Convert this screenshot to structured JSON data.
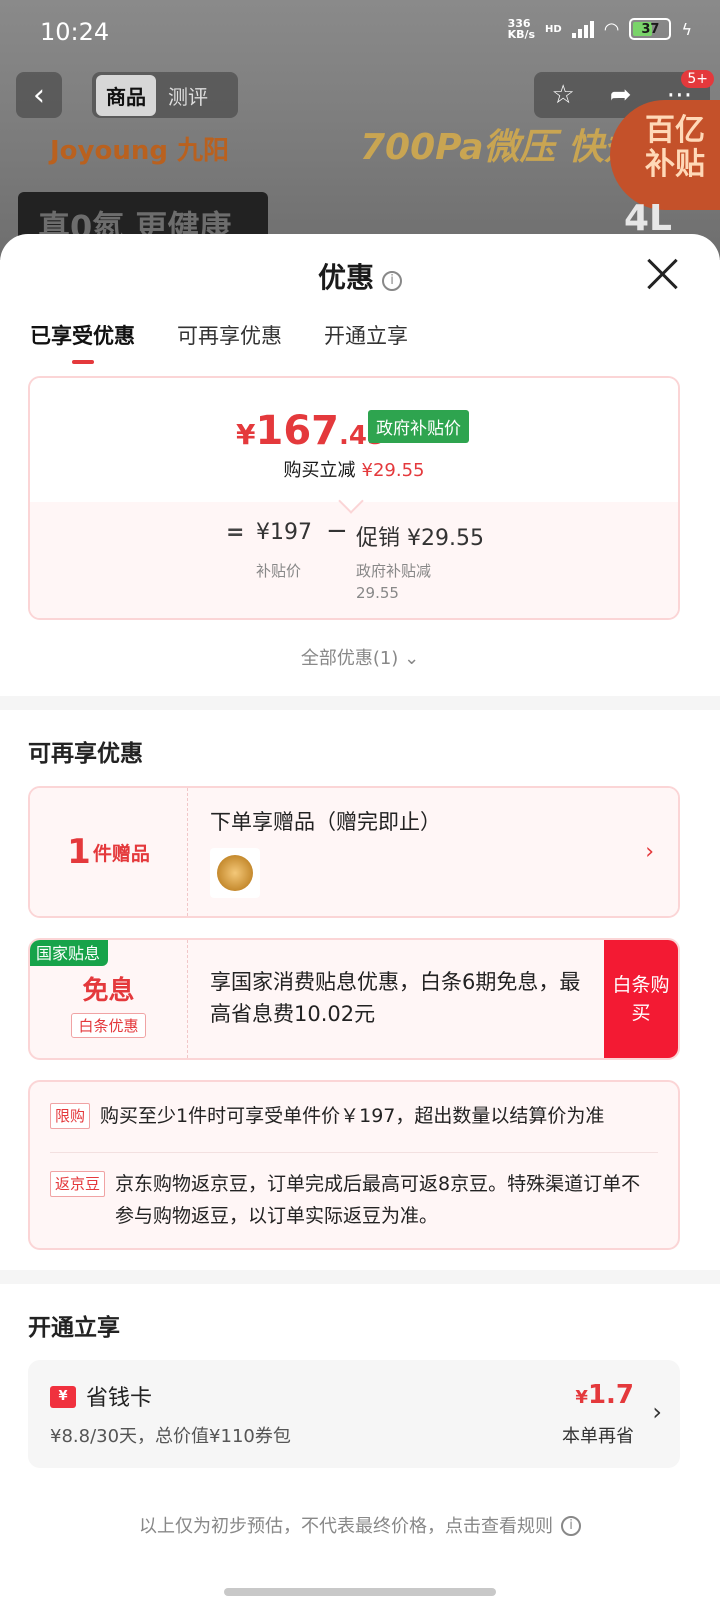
{
  "status": {
    "time": "10:24",
    "net_speed": "336",
    "net_unit": "KB/s",
    "hd": "HD",
    "battery": "37"
  },
  "background": {
    "tab_product": "商品",
    "tab_review": "测评",
    "brand": "Joyoung 九阳",
    "slogan": "700Pa微压 快煮",
    "subsidy_badge_1": "百亿",
    "subsidy_badge_2": "补贴",
    "banner_text": "真0氮 更健康",
    "size": "4L",
    "more_badge": "5+"
  },
  "sheet": {
    "title": "优惠",
    "tabs": [
      "已享受优惠",
      "可再享优惠",
      "开通立享"
    ],
    "price": {
      "yen": "¥",
      "integer": "167",
      "decimal": ".45",
      "badge": "政府补贴价"
    },
    "reduce_label": "购买立减",
    "reduce_amount": "¥29.55",
    "calc": {
      "eq": "=",
      "base": "¥197",
      "minus": "−",
      "promo": "促销 ¥29.55",
      "base_label": "补贴价",
      "promo_label_1": "政府补贴减",
      "promo_label_2": "29.55"
    },
    "all_offers": "全部优惠(1)",
    "section_more": "可再享优惠",
    "gift": {
      "count": "1",
      "count_label": "件赠品",
      "title": "下单享赠品（赠完即止）"
    },
    "interest": {
      "tag": "国家贴息",
      "big": "免息",
      "small": "白条优惠",
      "desc": "享国家消费贴息优惠，白条6期免息，最高省息费10.02元",
      "button": "白条购买"
    },
    "notes": [
      {
        "tag": "限购",
        "text": "购买至少1件时可享受单件价￥197，超出数量以结算价为准"
      },
      {
        "tag": "返京豆",
        "text": "京东购物返京豆，订单完成后最高可返8京豆。特殊渠道订单不参与购物返豆，以订单实际返豆为准。"
      }
    ],
    "section_open": "开通立享",
    "saver": {
      "icon": "¥",
      "name": "省钱卡",
      "desc": "¥8.8/30天，总价值¥110券包",
      "amount_yen": "¥",
      "amount": "1.7",
      "sub": "本单再省"
    },
    "footer": "以上仅为初步预估，不代表最终价格，点击查看规则"
  }
}
